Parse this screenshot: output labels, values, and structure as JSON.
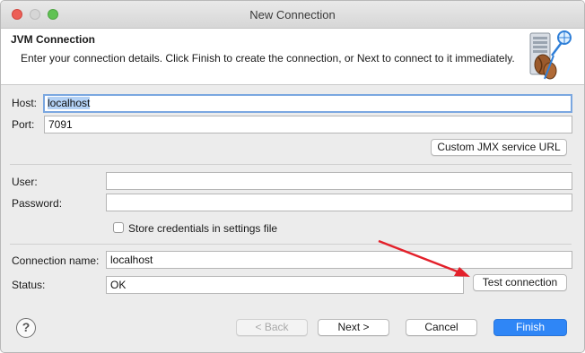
{
  "window": {
    "title": "New Connection"
  },
  "header": {
    "title": "JVM Connection",
    "description": "Enter your connection details. Click Finish to create the connection, or Next to connect to it immediately.",
    "icon": "jvm-connection-icon"
  },
  "connection": {
    "host_label": "Host:",
    "host_value": "localhost",
    "port_label": "Port:",
    "port_value": "7091",
    "custom_jmx_button": "Custom JMX service URL"
  },
  "credentials": {
    "user_label": "User:",
    "user_value": "",
    "password_label": "Password:",
    "password_value": "",
    "store_credentials_label": "Store credentials in settings file",
    "store_credentials_checked": false
  },
  "details": {
    "connection_name_label": "Connection name:",
    "connection_name_value": "localhost",
    "status_label": "Status:",
    "status_value": "OK",
    "test_connection_button": "Test connection"
  },
  "footer": {
    "help_symbol": "?",
    "back_button": "< Back",
    "next_button": "Next >",
    "cancel_button": "Cancel",
    "finish_button": "Finish"
  },
  "colors": {
    "primary_button": "#2f86f6",
    "focus_ring": "#7aa7e0",
    "annotation_arrow": "#e3202a"
  }
}
